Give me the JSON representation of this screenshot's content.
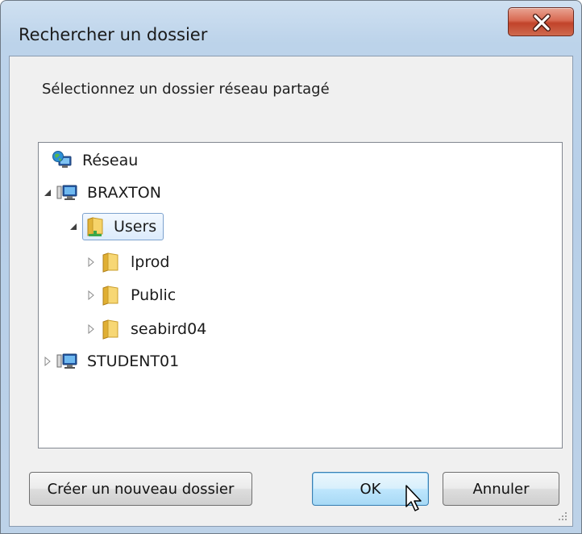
{
  "window": {
    "title": "Rechercher un dossier",
    "close_label": "x"
  },
  "dialog": {
    "instruction": "Sélectionnez un dossier réseau partagé"
  },
  "tree": {
    "items": [
      {
        "label": "Réseau",
        "icon": "network-globe-icon",
        "level": 0,
        "expander": "none",
        "selected": false
      },
      {
        "label": "BRAXTON",
        "icon": "computer-icon",
        "level": 0,
        "expander": "expanded",
        "selected": false
      },
      {
        "label": "Users",
        "icon": "shared-folder-icon",
        "level": 1,
        "expander": "expanded",
        "selected": true
      },
      {
        "label": "lprod",
        "icon": "folder-icon",
        "level": 2,
        "expander": "collapsed",
        "selected": false
      },
      {
        "label": "Public",
        "icon": "folder-icon",
        "level": 2,
        "expander": "collapsed",
        "selected": false
      },
      {
        "label": "seabird04",
        "icon": "folder-icon",
        "level": 2,
        "expander": "collapsed",
        "selected": false
      },
      {
        "label": "STUDENT01",
        "icon": "computer-icon",
        "level": 0,
        "expander": "collapsed",
        "selected": false
      }
    ]
  },
  "buttons": {
    "new_folder": "Créer un nouveau dossier",
    "ok": "OK",
    "cancel": "Annuler"
  },
  "colors": {
    "accent": "#3c7fb1",
    "close": "#c1432a",
    "selection": "#dcebfc"
  }
}
